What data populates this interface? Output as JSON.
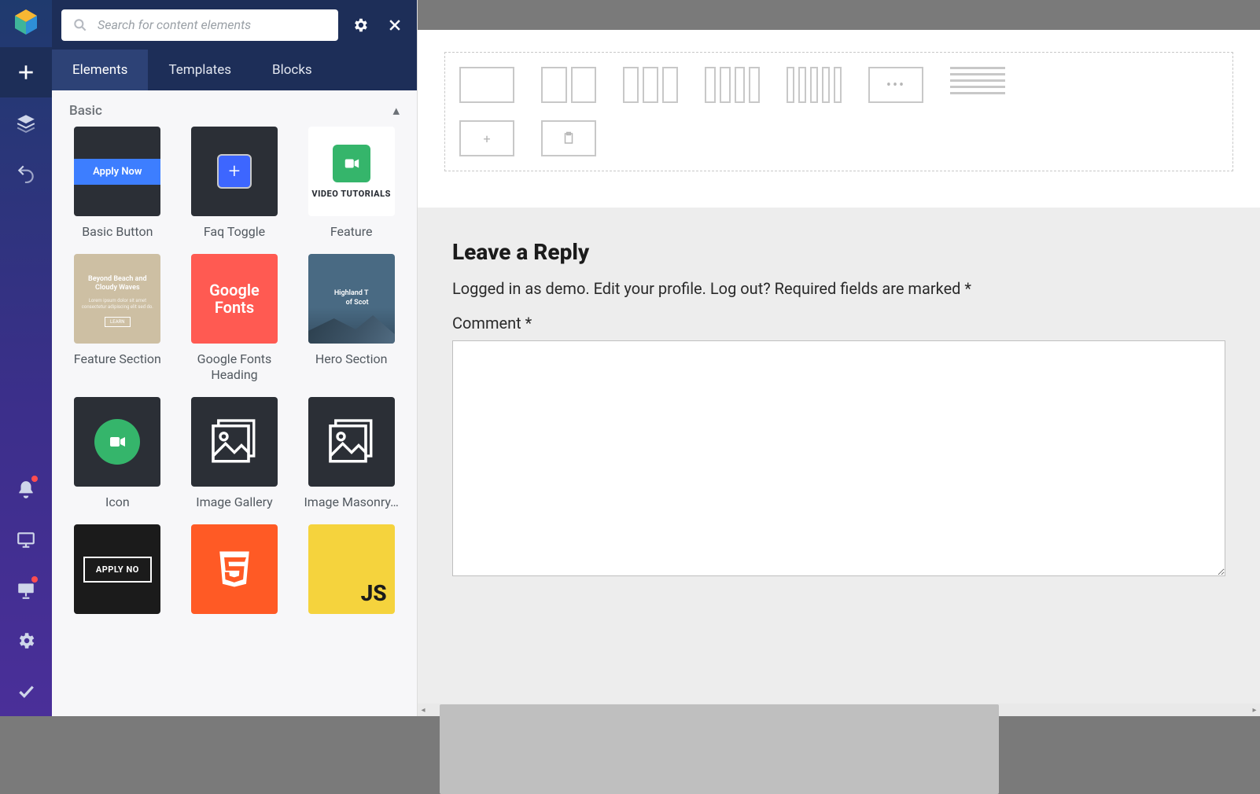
{
  "search": {
    "placeholder": "Search for content elements"
  },
  "tabs": [
    {
      "label": "Elements",
      "active": true
    },
    {
      "label": "Templates",
      "active": false
    },
    {
      "label": "Blocks",
      "active": false
    }
  ],
  "section": {
    "title": "Basic"
  },
  "elements": [
    {
      "key": "basic-button",
      "label": "Basic Button",
      "inner": "Apply Now"
    },
    {
      "key": "faq-toggle",
      "label": "Faq Toggle"
    },
    {
      "key": "feature",
      "label": "Feature",
      "caption": "VIDEO TUTORIALS"
    },
    {
      "key": "feature-section",
      "label": "Feature Section",
      "caption": "Beyond Beach and Cloudy Waves"
    },
    {
      "key": "google-fonts-heading",
      "label": "Google Fonts Heading",
      "caption": "Google Fonts"
    },
    {
      "key": "hero-section",
      "label": "Hero Section",
      "caption": "Highland T\nof Scot"
    },
    {
      "key": "icon",
      "label": "Icon"
    },
    {
      "key": "image-gallery",
      "label": "Image Gallery"
    },
    {
      "key": "image-masonry",
      "label": "Image Masonry…"
    },
    {
      "key": "outline-button",
      "label": "",
      "inner": "APPLY NO"
    },
    {
      "key": "html5",
      "label": ""
    },
    {
      "key": "js",
      "label": "",
      "inner": "JS"
    }
  ],
  "reply": {
    "heading": "Leave a Reply",
    "meta": "Logged in as demo. Edit your profile. Log out? Required fields are marked *",
    "comment_label": "Comment *"
  }
}
